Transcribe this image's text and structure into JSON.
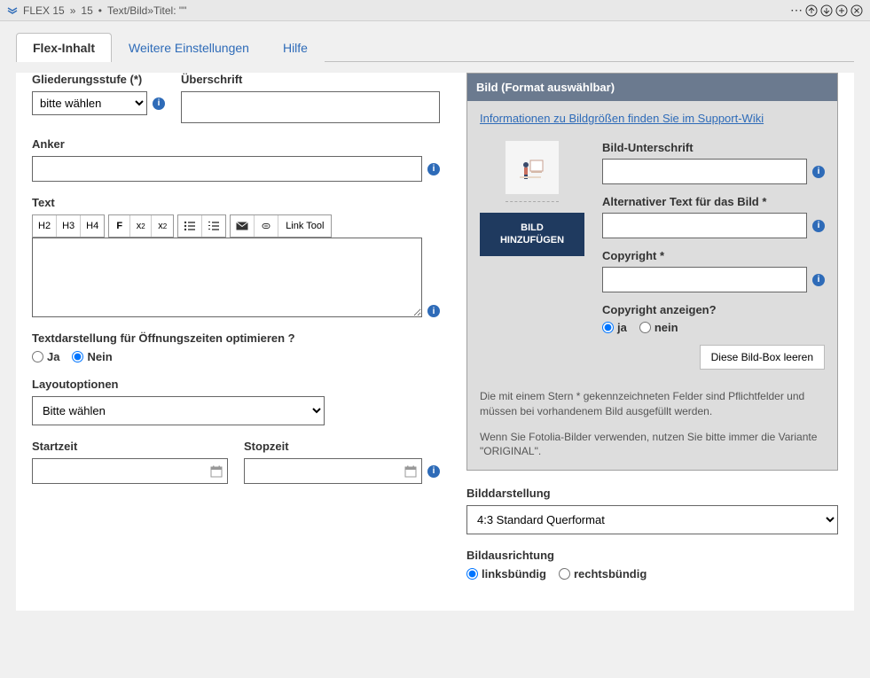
{
  "titlebar": {
    "app": "FLEX 15",
    "crumb_sep": "»",
    "item_no": "15",
    "item_type": "Text/Bild",
    "item_title_label": "Titel:",
    "item_title": "\"\""
  },
  "tabs": {
    "active": "Flex-Inhalt",
    "t1": "Flex-Inhalt",
    "t2": "Weitere Einstellungen",
    "t3": "Hilfe"
  },
  "left": {
    "gliederung_label": "Gliederungsstufe (*)",
    "gliederung_value": "bitte wählen",
    "ueberschrift_label": "Überschrift",
    "anker_label": "Anker",
    "text_label": "Text",
    "toolbar": {
      "h2": "H2",
      "h3": "H3",
      "h4": "H4",
      "linktool": "Link Tool"
    },
    "oeffnungszeiten_label": "Textdarstellung für Öffnungszeiten optimieren ?",
    "ja": "Ja",
    "nein": "Nein",
    "layout_label": "Layoutoptionen",
    "layout_value": "Bitte wählen",
    "startzeit_label": "Startzeit",
    "stopzeit_label": "Stopzeit"
  },
  "right": {
    "panel_title": "Bild (Format auswählbar)",
    "support_link": "Informationen zu Bildgrößen finden Sie im Support-Wiki",
    "add_image": "BILD HINZUFÜGEN",
    "bild_unterschrift_label": "Bild-Unterschrift",
    "alt_text_label": "Alternativer Text für das Bild *",
    "copyright_label": "Copyright *",
    "copyright_show_label": "Copyright anzeigen?",
    "copyright_ja": "ja",
    "copyright_nein": "nein",
    "clear_box": "Diese Bild-Box leeren",
    "hint1": "Die mit einem Stern * gekennzeichneten Felder sind Pflichtfelder und müssen bei vorhandenem Bild ausgefüllt werden.",
    "hint2": "Wenn Sie Fotolia-Bilder verwenden, nutzen Sie bitte immer die Variante \"ORIGINAL\".",
    "bilddarstellung_label": "Bilddarstellung",
    "bilddarstellung_value": "4:3 Standard Querformat",
    "bildausrichtung_label": "Bildausrichtung",
    "links": "linksbündig",
    "rechts": "rechtsbündig"
  }
}
